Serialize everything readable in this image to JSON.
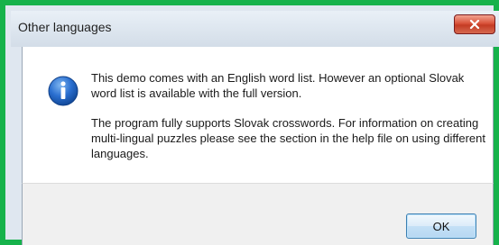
{
  "window": {
    "title": "Other languages"
  },
  "message": {
    "paragraph1": "This demo comes with an English word list. However an optional Slovak word list is available with the full version.",
    "paragraph2": "The program fully supports Slovak crosswords. For information on creating multi-lingual puzzles please see the section in the help file on using different languages."
  },
  "buttons": {
    "ok_label": "OK"
  },
  "icons": {
    "message_icon": "info-icon",
    "close_icon": "close-icon"
  },
  "colors": {
    "accent_border": "#16b24b",
    "close_button": "#c43b23",
    "info_icon": "#1f5fb7"
  }
}
